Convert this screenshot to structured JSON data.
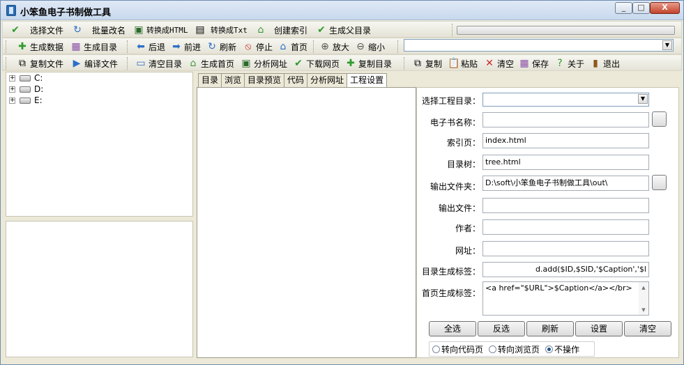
{
  "window": {
    "title": "小笨鱼电子书制做工具",
    "min": "_",
    "max": "□",
    "close": "X"
  },
  "toolbar1": {
    "select_file": "选择文件",
    "batch_rename": "批量改名",
    "to_html": "转换成HTML",
    "to_txt": "转换成Txt",
    "create_index": "创建索引",
    "gen_parent_dir": "生成父目录"
  },
  "toolbar2": {
    "gen_data": "生成数据",
    "gen_dir": "生成目录",
    "back": "后退",
    "forward": "前进",
    "refresh": "刷新",
    "stop": "停止",
    "home": "首页",
    "zoom_in": "放大",
    "zoom_out": "缩小"
  },
  "toolbar3": {
    "copy_file": "复制文件",
    "compile_file": "编译文件",
    "clear_dir": "清空目录",
    "gen_homepage": "生成首页",
    "analyze_url": "分析网址",
    "download_page": "下载网页",
    "copy_dir": "复制目录",
    "copy": "复制",
    "paste": "粘贴",
    "clear": "清空",
    "save": "保存",
    "about": "关于",
    "exit": "退出"
  },
  "tree": {
    "drives": [
      "C:",
      "D:",
      "E:"
    ]
  },
  "tabs": [
    "目录",
    "浏览",
    "目录预览",
    "代码",
    "分析网址",
    "工程设置"
  ],
  "settings": {
    "project_dir_label": "选择工程目录：",
    "ebook_name_label": "电子书名称：",
    "index_page_label": "索引页：",
    "index_page_value": "index.html",
    "tree_label": "目录树：",
    "tree_value": "tree.html",
    "output_folder_label": "输出文件夹：",
    "output_folder_value": "D:\\soft\\小笨鱼电子书制做工具\\out\\",
    "output_file_label": "输出文件：",
    "author_label": "作者：",
    "url_label": "网址：",
    "dir_tag_label": "目录生成标签：",
    "dir_tag_value": "d.add($ID,$SID,'$Caption','$l",
    "home_tag_label": "首页生成标签：",
    "home_tag_value": "<a href=\"$URL\">$Caption</a></br>"
  },
  "actions": {
    "select_all": "全选",
    "invert": "反选",
    "refresh": "刷新",
    "settings": "设置",
    "clear": "清空"
  },
  "radios": {
    "to_code": "转向代码页",
    "to_browse": "转向浏览页",
    "no_action": "不操作",
    "selected": "no_action"
  }
}
